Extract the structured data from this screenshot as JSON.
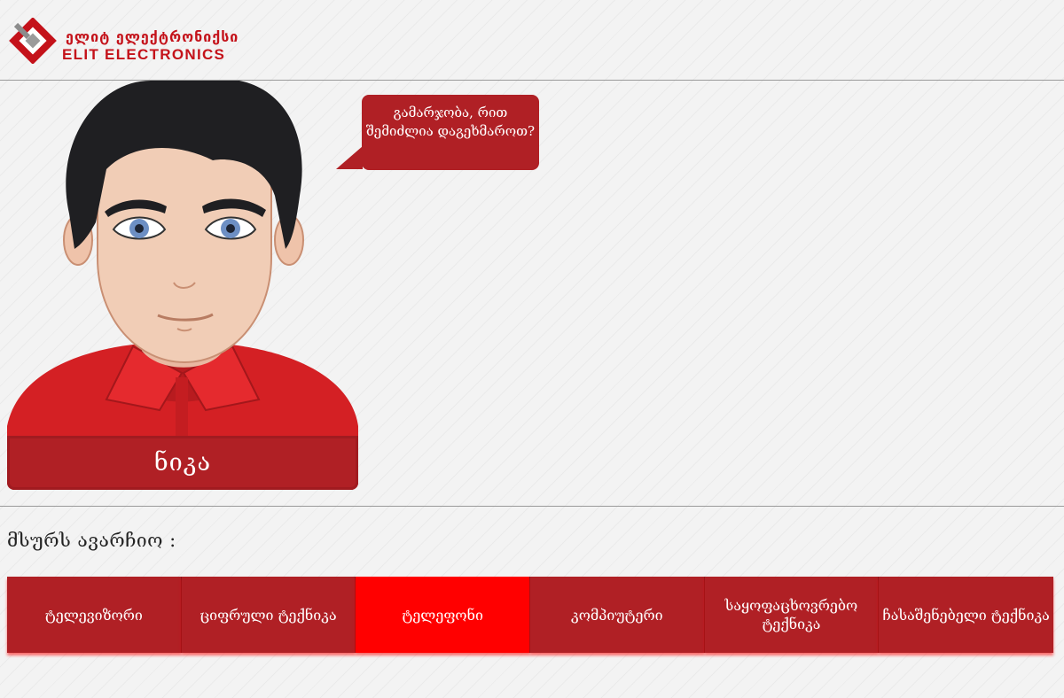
{
  "logo": {
    "text_ka": "ელიტ ელექტრონიქსი",
    "text_en": "ELIT ELECTRONICS"
  },
  "assistant": {
    "name": "ნიკა",
    "greeting": "გამარჯობა, რით შემიძლია დაგეხმაროთ?"
  },
  "prompt": "მსურს ავარჩიო :",
  "categories": [
    {
      "label": "ტელევიზორი",
      "active": false
    },
    {
      "label": "ციფრული ტექნიკა",
      "active": false
    },
    {
      "label": "ტელეფონი",
      "active": true
    },
    {
      "label": "კომპიუტერი",
      "active": false
    },
    {
      "label": "საყოფაცხოვრებო ტექნიკა",
      "active": false
    },
    {
      "label": "ჩასაშენებელი ტექნიკა",
      "active": false
    }
  ],
  "colors": {
    "brand_red": "#c4121a",
    "button_red": "#b02025",
    "active_red": "#ff0000"
  },
  "icons": {
    "logo": "elit-logo-icon",
    "avatar": "assistant-avatar"
  }
}
